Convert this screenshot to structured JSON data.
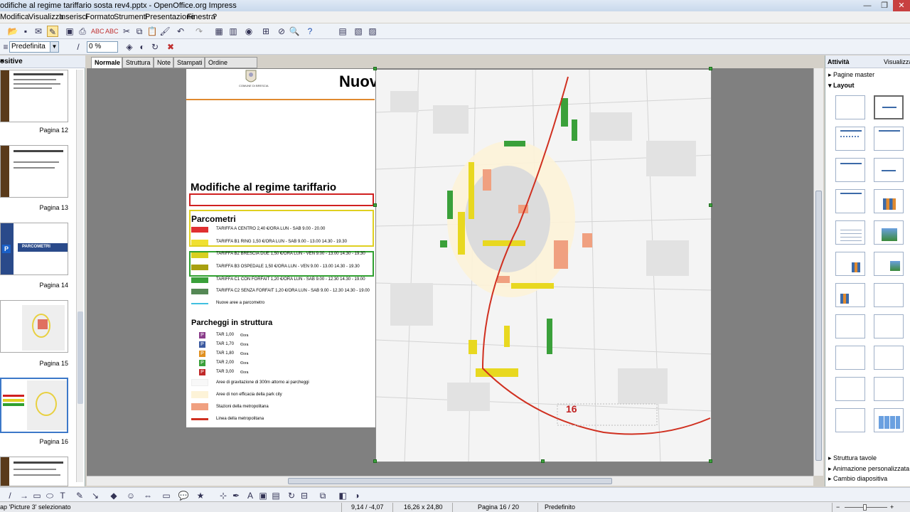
{
  "window": {
    "title": "odifiche al regime tariffario sosta rev4.pptx - OpenOffice.org Impress",
    "minimize": "—",
    "maximize": "❐",
    "close": "✕"
  },
  "menu": [
    "Modifica",
    "Visualizza",
    "Inserisci",
    "Formato",
    "Strumenti",
    "Presentazione",
    "Finestra",
    "?"
  ],
  "toolbar2": {
    "style_value": "Predefinita",
    "zoom_value": "0 %"
  },
  "slides_panel": {
    "title": "ositive",
    "close": "×",
    "items": [
      {
        "label": "Pagina 12"
      },
      {
        "label": "Pagina 13"
      },
      {
        "label": "Pagina 14",
        "text": "PARCOMETRI"
      },
      {
        "label": "Pagina 15"
      },
      {
        "label": "Pagina 16"
      },
      {
        "label": ""
      }
    ]
  },
  "view_tabs": [
    "Normale",
    "Struttura",
    "Note",
    "Stampati",
    "Ordine diapositive"
  ],
  "slide": {
    "heading": "Nuove Tariffe",
    "logo_caption": "COMUNE DI BRESCIA",
    "section_title": "Modifiche al regime tariffario",
    "box_a": "A",
    "box_b": "B",
    "box_c": "C",
    "parcometri_title": "Parcometri",
    "tariffs": [
      {
        "text": "TARIFFA A CENTRO 2,40 €/ORA LUN - SAB  9.00 - 20.00",
        "color": "#e03030"
      },
      {
        "text": "TARIFFA B1 RING 1,50 €/ORA LUN - SAB  9.00 - 13.00  14.30 - 19.30",
        "color": "#f0e030"
      },
      {
        "text": "TARIFFA B2 BRESCIA DUE 1,50 €/ORA LUN - VEN 9.00 - 13.00 14.30 - 19.30",
        "color": "#d8d020"
      },
      {
        "text": "TARIFFA B3 OSPEDALE 1,50 €/ORA LUN - VEN 9.00 - 13.00 14.30 - 19.30",
        "color": "#a8a010"
      },
      {
        "text": "TARIFFA C1 CON FORFAIT 1,20 €/ORA LUN - SAB  9.00 - 12.30  14.30 - 19.00",
        "color": "#3aa03a"
      },
      {
        "text": "TARIFFA C2 SENZA FORFAIT 1,20 €/ORA LUN - SAB 9.00 - 12.30  14.30 - 19.00",
        "color": "#558855"
      },
      {
        "text": "Nuove aree a parcometro",
        "color": "#40c0e0"
      }
    ],
    "parcheggi_title": "Parcheggi in struttura",
    "parcheggi": [
      {
        "letter": "P",
        "text": "TAR  1,00",
        "unit": "€/ora",
        "color": "#8a3c8a"
      },
      {
        "letter": "P",
        "text": "TAR  1,70",
        "unit": "€/ora",
        "color": "#3c5aa0"
      },
      {
        "letter": "P",
        "text": "TAR  1,80",
        "unit": "€/ora",
        "color": "#e09020"
      },
      {
        "letter": "P",
        "text": "TAR  2,00",
        "unit": "€/ora",
        "color": "#3aa03a"
      },
      {
        "letter": "P",
        "text": "TAR  3,00",
        "unit": "€/ora",
        "color": "#c02828"
      }
    ],
    "areas": [
      {
        "text": "Aree di gravitazione di 300m attorno ai parcheggi",
        "color": "#f8f8f8"
      },
      {
        "text": "Aree di non efficacia della park city",
        "color": "#fdf3d8"
      },
      {
        "text": "Stazioni della metropolitana",
        "color": "#f0a080"
      },
      {
        "text": "Linea della metropolitana",
        "color": "#d03020"
      }
    ],
    "map_page_number": "16"
  },
  "tasks_panel": {
    "title": "Attività",
    "view": "Visualizza",
    "master_pages": "Pagine master",
    "layout": "Layout",
    "table_design": "Struttura tavole",
    "custom_animation": "Animazione personalizzata",
    "slide_transition": "Cambio diapositiva"
  },
  "status": {
    "selection": "ap 'Picture 3' selezionato",
    "position": "9,14 / -4,07",
    "size": "16,26 x 24,80",
    "page": "Pagina 16 / 20",
    "master": "Predefinito"
  },
  "colors": {
    "accent": "#3c78c8",
    "box_a": "#d02020",
    "box_b": "#e0d020",
    "box_c": "#30a030",
    "page_number": "#c02020"
  }
}
